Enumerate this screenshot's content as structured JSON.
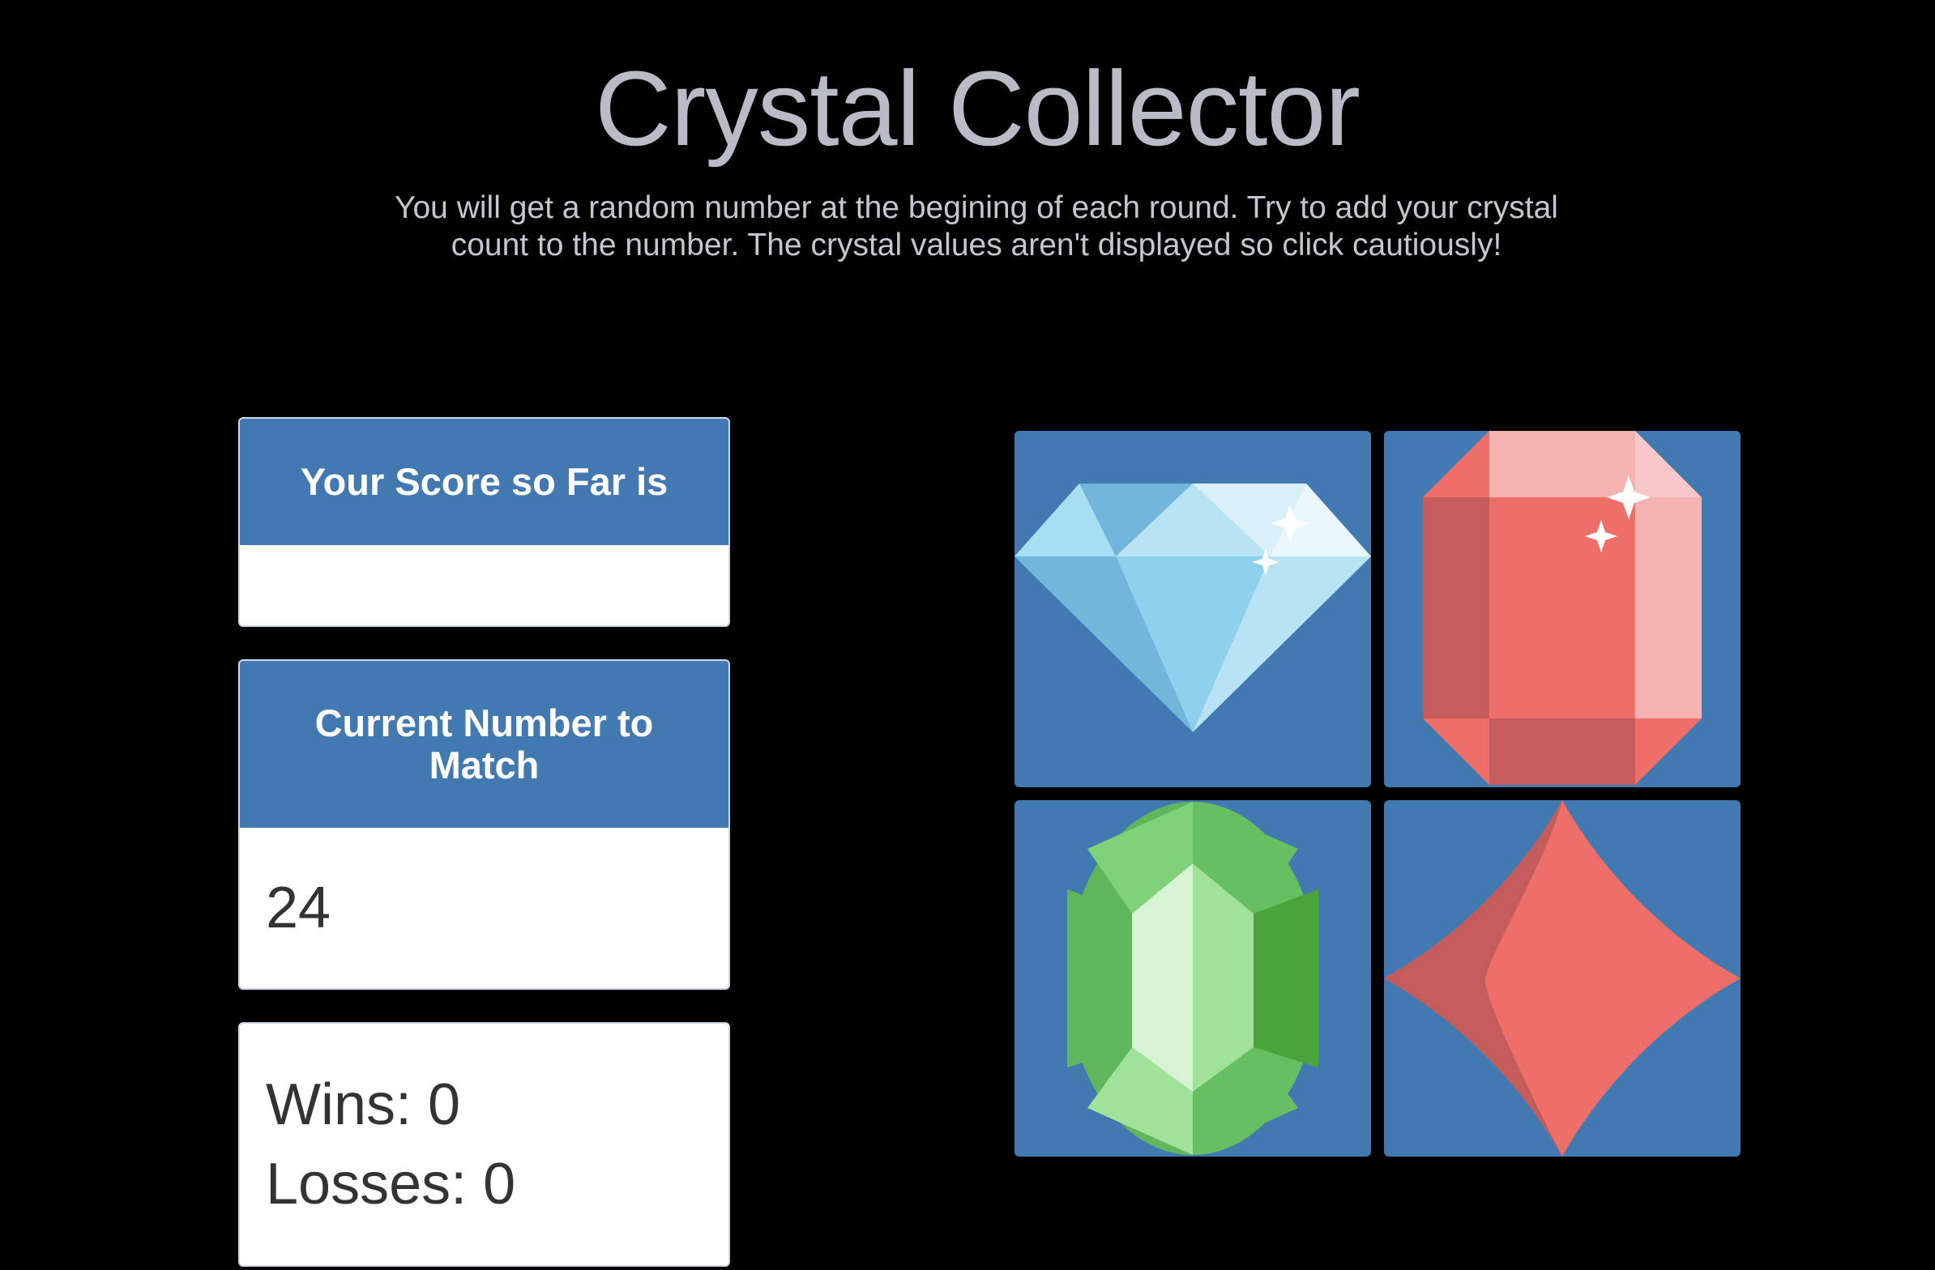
{
  "header": {
    "title": "Crystal Collector",
    "instructions": "You will get a random number at the begining of each round. Try to add your crystal count to the number. The crystal values aren't displayed so click cautiously!"
  },
  "score": {
    "heading": "Your Score so Far is",
    "value": ""
  },
  "target": {
    "heading": "Current Number to Match",
    "value": "24"
  },
  "record": {
    "wins_label": "Wins: 0",
    "losses_label": "Losses: 0"
  },
  "crystals": [
    {
      "name": "blue-diamond-icon",
      "color": "#8fd1ec"
    },
    {
      "name": "red-ruby-icon",
      "color": "#ee6e6a"
    },
    {
      "name": "green-emerald-icon",
      "color": "#66c061"
    },
    {
      "name": "red-rhombus-icon",
      "color": "#ee6e6a"
    }
  ],
  "colors": {
    "background": "#000000",
    "accent": "#4279b0",
    "title": "#b9bcc6"
  }
}
